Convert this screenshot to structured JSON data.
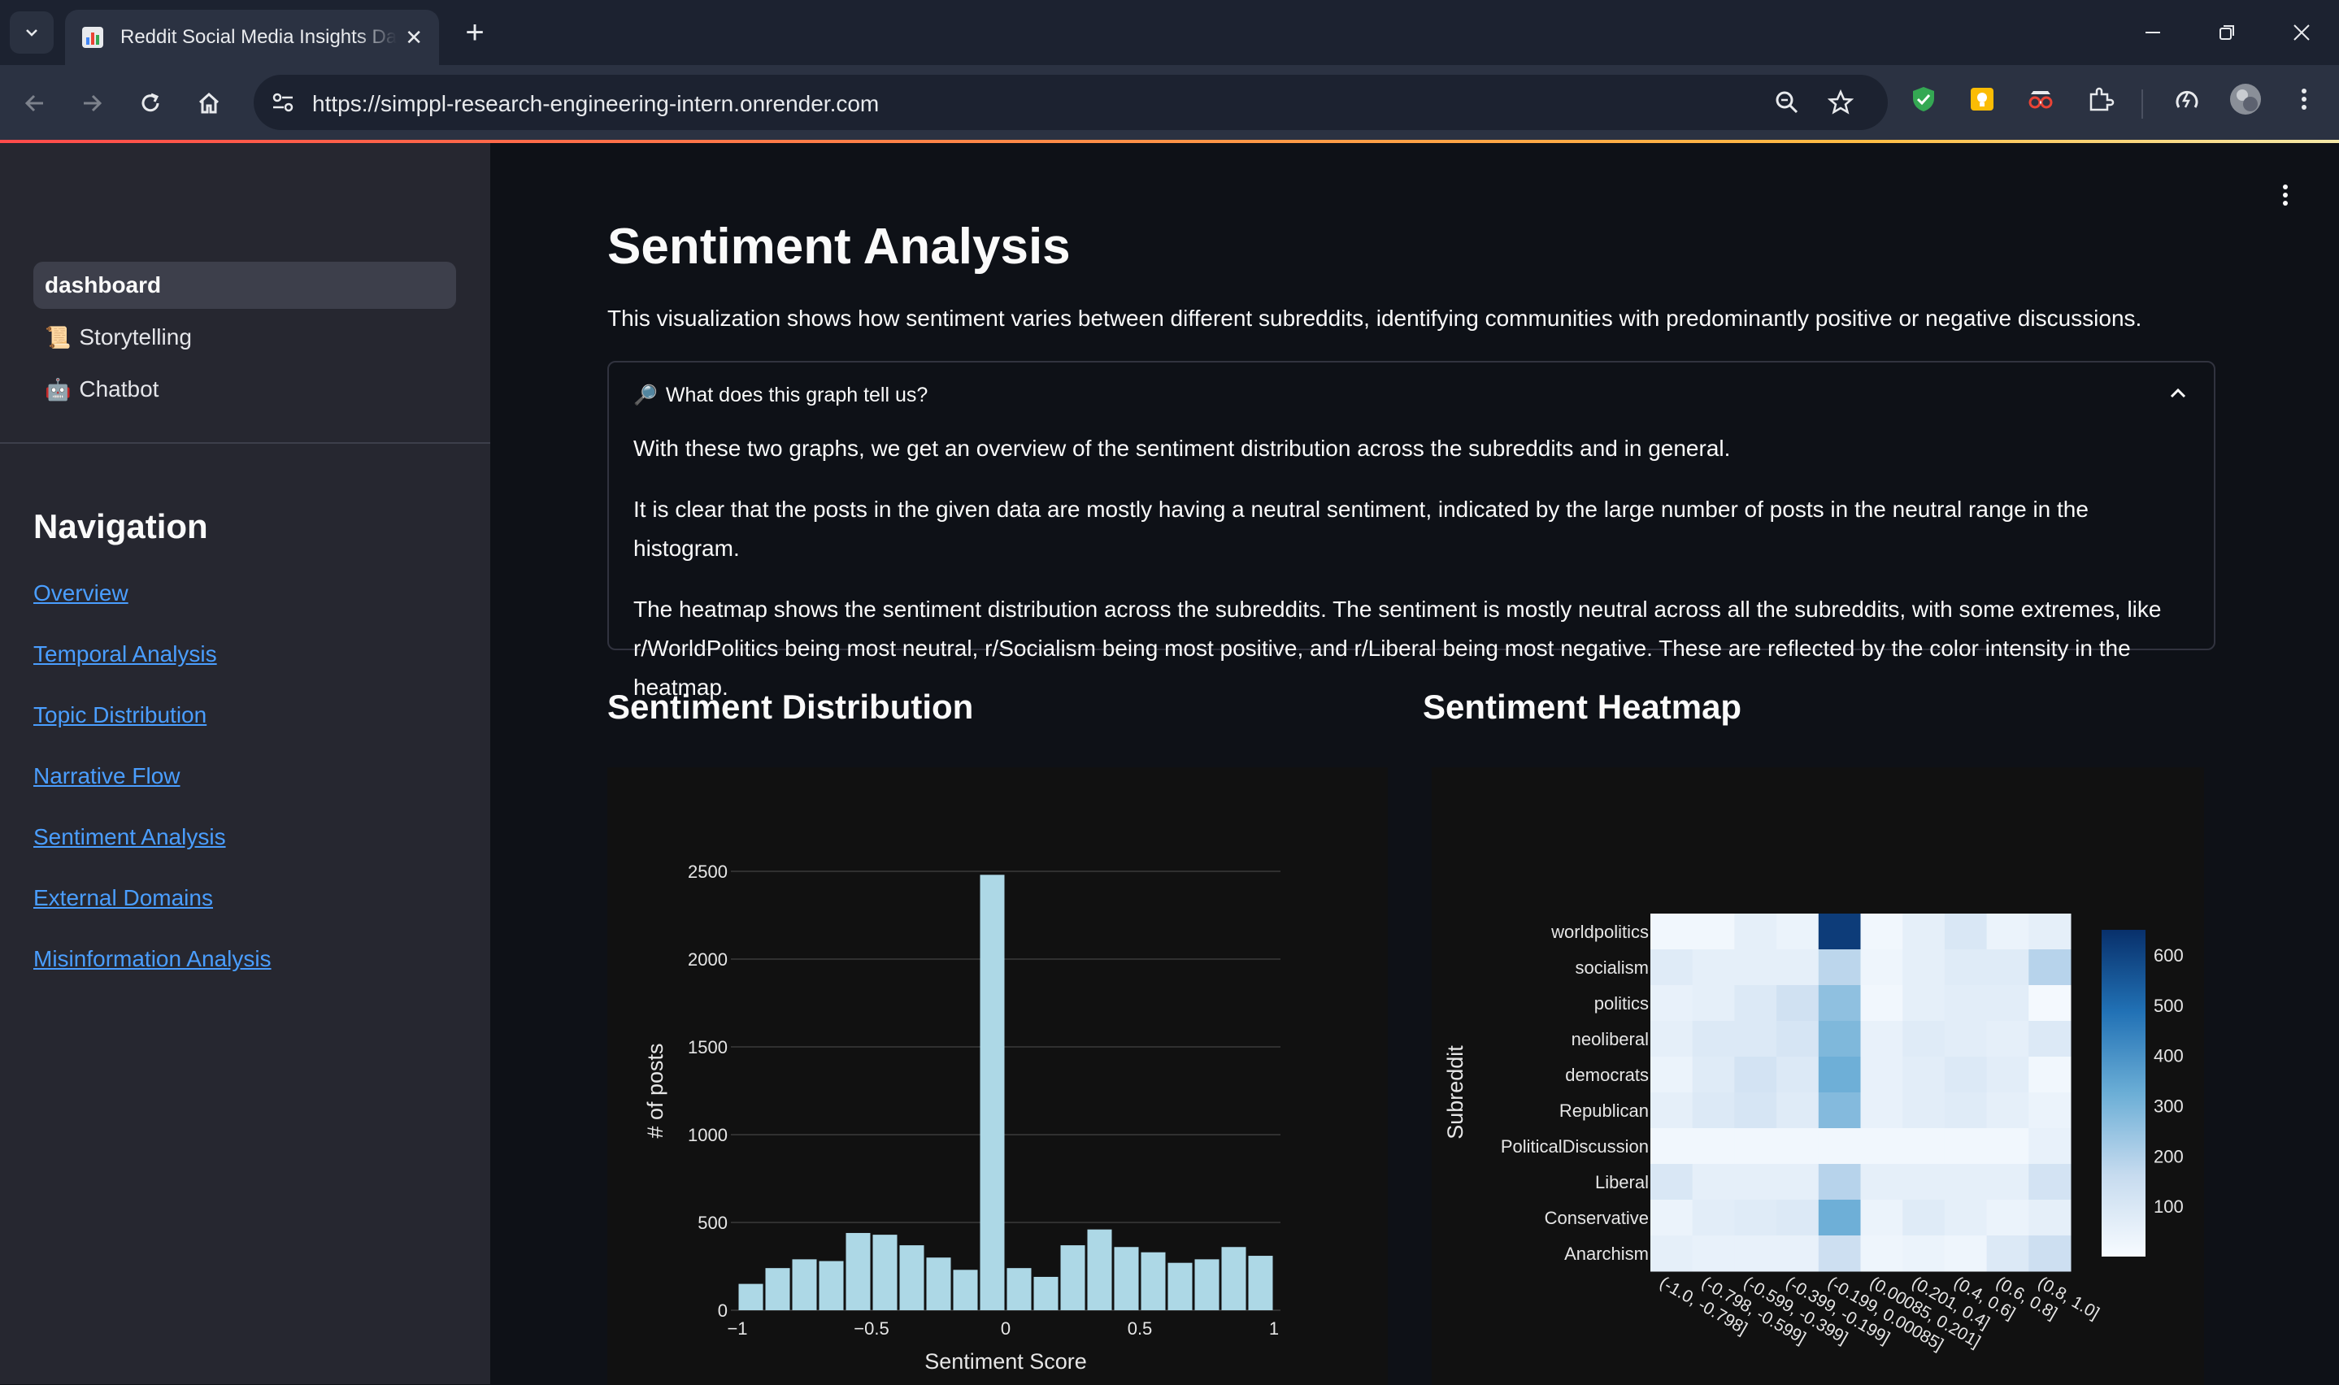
{
  "browser": {
    "tab_title": "Reddit Social Media Insights Dashboard",
    "url": "https://simppl-research-engineering-intern.onrender.com"
  },
  "sidebar": {
    "pages": [
      {
        "label": "dashboard",
        "icon": "",
        "active": true
      },
      {
        "label": "Storytelling",
        "icon": "📜",
        "active": false
      },
      {
        "label": "Chatbot",
        "icon": "🤖",
        "active": false
      }
    ],
    "nav_title": "Navigation",
    "nav_links": [
      "Overview",
      "Temporal Analysis",
      "Topic Distribution",
      "Narrative Flow",
      "Sentiment Analysis",
      "External Domains",
      "Misinformation Analysis"
    ]
  },
  "main": {
    "title": "Sentiment Analysis",
    "intro": "This visualization shows how sentiment varies between different subreddits, identifying communities with predominantly positive or negative discussions.",
    "expander": {
      "icon": "🔎",
      "label": "What does this graph tell us?",
      "paragraphs": [
        "With these two graphs, we get an overview of the sentiment distribution across the subreddits and in general.",
        "It is clear that the posts in the given data are mostly having a neutral sentiment, indicated by the large number of posts in the neutral range in the histogram.",
        "The heatmap shows the sentiment distribution across the subreddits. The sentiment is mostly neutral across all the subreddits, with some extremes, like r/WorldPolitics being most neutral, r/Socialism being most positive, and r/Liberal being most negative. These are reflected by the color intensity in the heatmap."
      ]
    },
    "hist_title": "Sentiment Distribution",
    "heat_title": "Sentiment Heatmap"
  },
  "chart_data": [
    {
      "type": "bar",
      "xlabel": "Sentiment Score",
      "ylabel": "# of posts",
      "xlim": [
        -1,
        1
      ],
      "ylim": [
        0,
        2500
      ],
      "x_ticks": [
        -1,
        -0.5,
        0,
        0.5,
        1
      ],
      "y_ticks": [
        0,
        500,
        1000,
        1500,
        2000,
        2500
      ],
      "bin_width": 0.1,
      "bin_starts": [
        -1.0,
        -0.9,
        -0.8,
        -0.7,
        -0.6,
        -0.5,
        -0.4,
        -0.3,
        -0.2,
        -0.1,
        0.0,
        0.1,
        0.2,
        0.3,
        0.4,
        0.5,
        0.6,
        0.7,
        0.8,
        0.9
      ],
      "values": [
        150,
        240,
        290,
        280,
        440,
        430,
        370,
        300,
        230,
        2480,
        240,
        190,
        370,
        460,
        360,
        330,
        270,
        290,
        360,
        310
      ],
      "color": "#add8e6"
    },
    {
      "type": "heatmap",
      "ylabel": "Subreddit",
      "rows": [
        "worldpolitics",
        "socialism",
        "politics",
        "neoliberal",
        "democrats",
        "Republican",
        "PoliticalDiscussion",
        "Liberal",
        "Conservative",
        "Anarchism"
      ],
      "columns": [
        "(-1.0, -0.798]",
        "(-0.798, -0.599]",
        "(-0.599, -0.399]",
        "(-0.399, -0.199]",
        "(-0.199, 0.00085]",
        "(0.00085, 0.201]",
        "(0.201, 0.4]",
        "(0.4, 0.6]",
        "(0.6, 0.8]",
        "(0.8, 1.0]"
      ],
      "values": [
        [
          20,
          20,
          60,
          40,
          620,
          20,
          60,
          100,
          40,
          60
        ],
        [
          80,
          60,
          60,
          60,
          180,
          30,
          60,
          80,
          80,
          190
        ],
        [
          50,
          60,
          90,
          130,
          260,
          20,
          60,
          70,
          70,
          10
        ],
        [
          60,
          90,
          90,
          110,
          290,
          50,
          80,
          70,
          60,
          90
        ],
        [
          40,
          80,
          120,
          90,
          320,
          50,
          70,
          90,
          70,
          20
        ],
        [
          60,
          90,
          110,
          80,
          280,
          50,
          70,
          80,
          60,
          40
        ],
        [
          20,
          20,
          20,
          20,
          20,
          20,
          20,
          20,
          20,
          50
        ],
        [
          100,
          60,
          60,
          60,
          190,
          60,
          60,
          60,
          60,
          120
        ],
        [
          40,
          70,
          80,
          90,
          320,
          40,
          80,
          60,
          40,
          60
        ],
        [
          60,
          50,
          50,
          50,
          140,
          30,
          40,
          30,
          90,
          140
        ]
      ],
      "colorbar_ticks": [
        100,
        200,
        300,
        400,
        500,
        600
      ],
      "zlim": [
        0,
        650
      ],
      "colorscale": [
        "#f7fbff",
        "#c6dbef",
        "#6baed6",
        "#2171b5",
        "#08306b"
      ]
    }
  ]
}
